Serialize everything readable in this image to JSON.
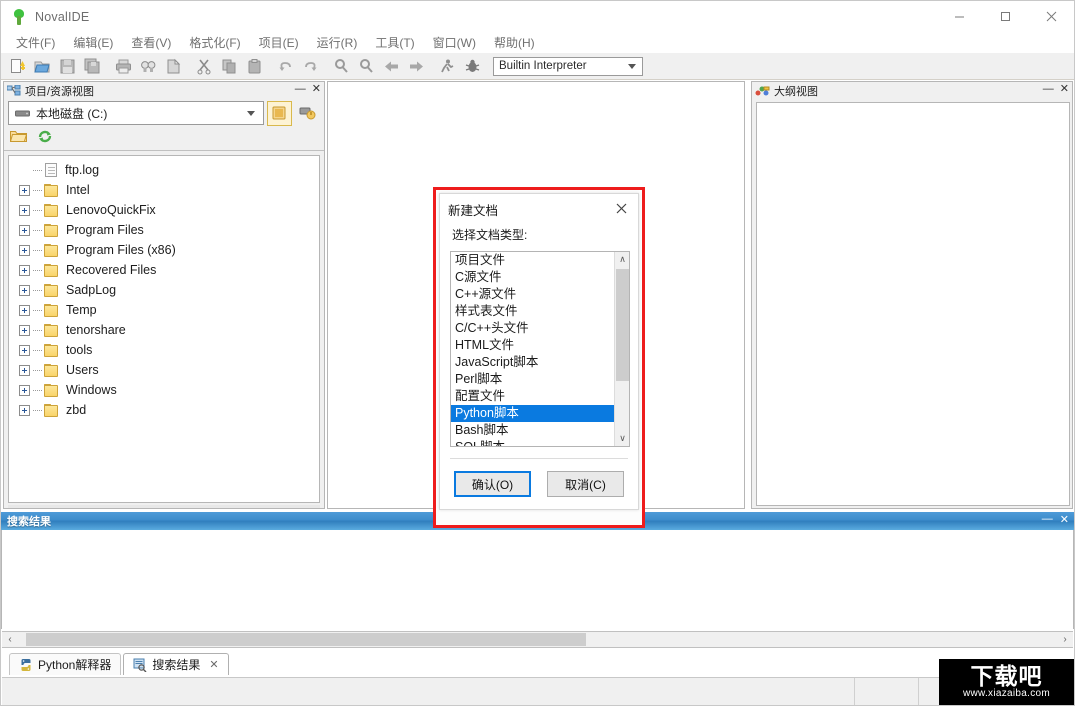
{
  "window": {
    "title": "NovalIDE",
    "icon": "app-leaf-icon",
    "controls": {
      "minimize": "—",
      "maximize": "☐",
      "close": "✕"
    }
  },
  "menubar": {
    "items": [
      {
        "label": "文件(F)"
      },
      {
        "label": "编辑(E)"
      },
      {
        "label": "查看(V)"
      },
      {
        "label": "格式化(F)"
      },
      {
        "label": "项目(E)"
      },
      {
        "label": "运行(R)"
      },
      {
        "label": "工具(T)"
      },
      {
        "label": "窗口(W)"
      },
      {
        "label": "帮助(H)"
      }
    ]
  },
  "toolbar": {
    "buttons": [
      {
        "name": "new-file-icon"
      },
      {
        "name": "open-file-icon"
      },
      {
        "name": "save-file-icon"
      },
      {
        "name": "save-all-icon"
      },
      {
        "name": "print-icon"
      },
      {
        "name": "find-icon"
      },
      {
        "name": "find-in-files-icon"
      },
      {
        "name": "cut-icon"
      },
      {
        "name": "copy-icon"
      },
      {
        "name": "paste-icon"
      },
      {
        "name": "undo-icon"
      },
      {
        "name": "redo-icon"
      },
      {
        "name": "zoom-in-icon"
      },
      {
        "name": "zoom-out-icon"
      },
      {
        "name": "back-icon"
      },
      {
        "name": "forward-icon"
      },
      {
        "name": "run-icon"
      },
      {
        "name": "debug-icon"
      }
    ],
    "interpreter": {
      "value": "Builtin Interpreter"
    }
  },
  "left_panel": {
    "title": "项目/资源视图",
    "minimize": "—",
    "close": "✕",
    "drive": {
      "value": "本地磁盘 (C:)"
    },
    "drive_buttons": [
      {
        "name": "browse-folder-button"
      },
      {
        "name": "network-drive-button"
      }
    ],
    "mini_tools": [
      {
        "name": "open-folder-button"
      },
      {
        "name": "refresh-button"
      }
    ],
    "tree": [
      {
        "label": "ftp.log",
        "type": "file",
        "expandable": false
      },
      {
        "label": "Intel",
        "type": "folder",
        "expandable": true
      },
      {
        "label": "LenovoQuickFix",
        "type": "folder",
        "expandable": true
      },
      {
        "label": "Program Files",
        "type": "folder",
        "expandable": true
      },
      {
        "label": "Program Files (x86)",
        "type": "folder",
        "expandable": true
      },
      {
        "label": "Recovered Files",
        "type": "folder",
        "expandable": true
      },
      {
        "label": "SadpLog",
        "type": "folder",
        "expandable": true
      },
      {
        "label": "Temp",
        "type": "folder",
        "expandable": true
      },
      {
        "label": "tenorshare",
        "type": "folder",
        "expandable": true
      },
      {
        "label": "tools",
        "type": "folder",
        "expandable": true
      },
      {
        "label": "Users",
        "type": "folder",
        "expandable": true
      },
      {
        "label": "Windows",
        "type": "folder",
        "expandable": true
      },
      {
        "label": "zbd",
        "type": "folder",
        "expandable": true
      }
    ]
  },
  "right_panel": {
    "title": "大纲视图",
    "minimize": "—",
    "close": "✕"
  },
  "search_panel": {
    "title": "搜索结果",
    "minimize": "—",
    "close": "✕"
  },
  "hscroll": {
    "left_arrow": "‹",
    "right_arrow": "›"
  },
  "bottom_tabs": [
    {
      "label": "Python解释器",
      "icon": "python-icon",
      "active": false,
      "closable": false
    },
    {
      "label": "搜索结果",
      "icon": "search-results-icon",
      "active": true,
      "closable": true,
      "close": "✕"
    }
  ],
  "dialog": {
    "title": "新建文档",
    "close": "✕",
    "label": "选择文档类型:",
    "list": [
      {
        "label": "项目文件",
        "selected": false
      },
      {
        "label": "C源文件",
        "selected": false
      },
      {
        "label": "C++源文件",
        "selected": false
      },
      {
        "label": "样式表文件",
        "selected": false
      },
      {
        "label": "C/C++头文件",
        "selected": false
      },
      {
        "label": "HTML文件",
        "selected": false
      },
      {
        "label": "JavaScript脚本",
        "selected": false
      },
      {
        "label": "Perl脚本",
        "selected": false
      },
      {
        "label": "配置文件",
        "selected": false
      },
      {
        "label": "Python脚本",
        "selected": true
      },
      {
        "label": "Bash脚本",
        "selected": false
      },
      {
        "label": "SQL脚本",
        "selected": false
      }
    ],
    "scroll_up": "∧",
    "scroll_down": "∨",
    "ok_button": "确认(O)",
    "cancel_button": "取消(C)",
    "highlight_color": "#ee1c1c",
    "selection_color": "#0a7ae0"
  },
  "watermark": {
    "logo": "下载吧",
    "url": "www.xiazaiba.com"
  }
}
